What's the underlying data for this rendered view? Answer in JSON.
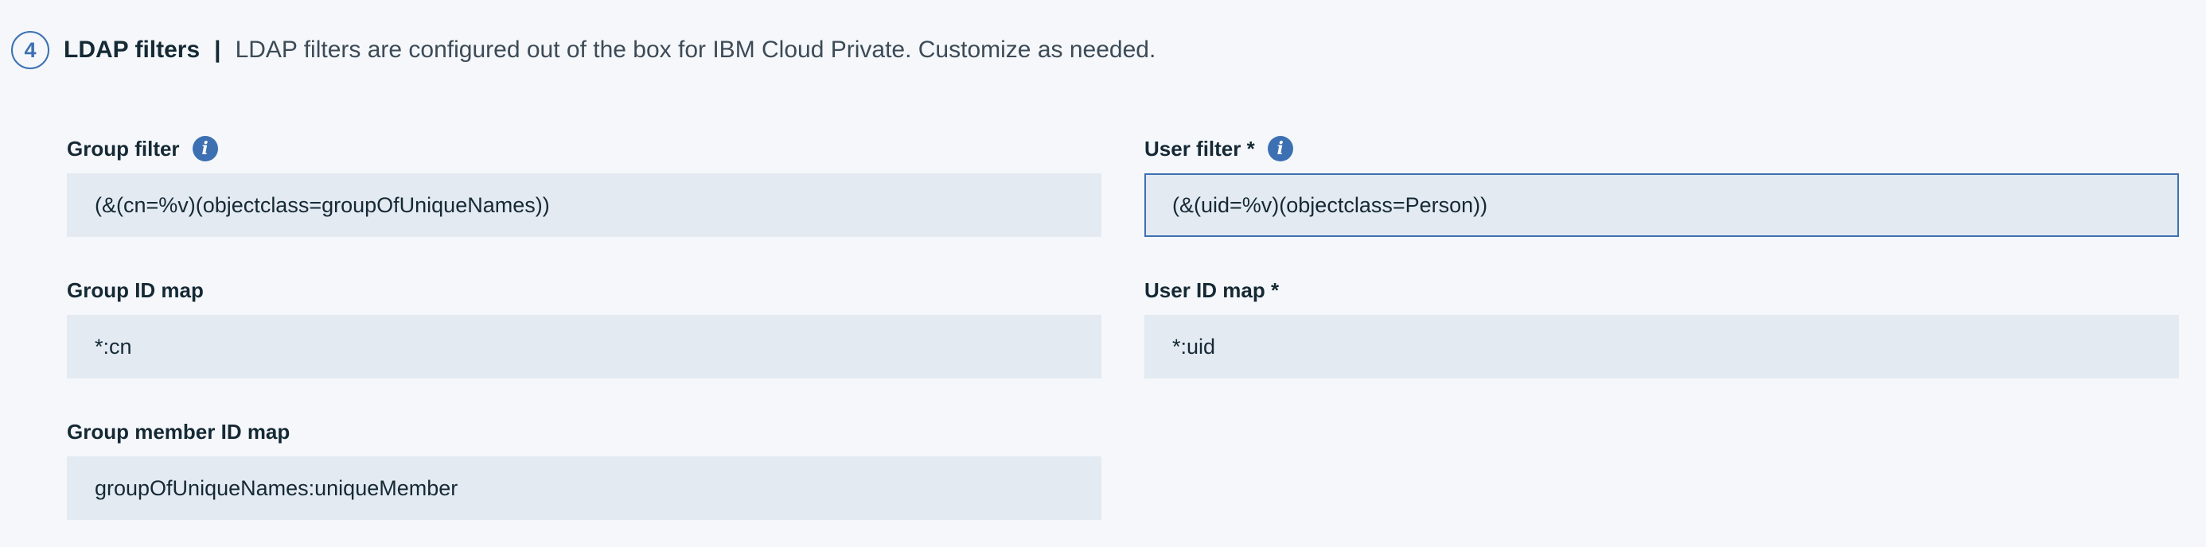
{
  "section": {
    "step": "4",
    "title": "LDAP filters",
    "separator": "|",
    "description": "LDAP filters are configured out of the box for IBM Cloud Private. Customize as needed."
  },
  "fields": {
    "group_filter": {
      "label": "Group filter",
      "value": "(&(cn=%v)(objectclass=groupOfUniqueNames))",
      "info_icon": "info-icon"
    },
    "user_filter": {
      "label": "User filter *",
      "value": "(&(uid=%v)(objectclass=Person))",
      "info_icon": "info-icon"
    },
    "group_id_map": {
      "label": "Group ID map",
      "value": "*:cn"
    },
    "user_id_map": {
      "label": "User ID map *",
      "value": "*:uid"
    },
    "group_member_id_map": {
      "label": "Group member ID map",
      "value": "groupOfUniqueNames:uniqueMember"
    }
  },
  "colors": {
    "accent": "#3d70b2",
    "input_background": "#e3eaf2",
    "page_background": "#f5f7fa",
    "text": "#152935"
  }
}
